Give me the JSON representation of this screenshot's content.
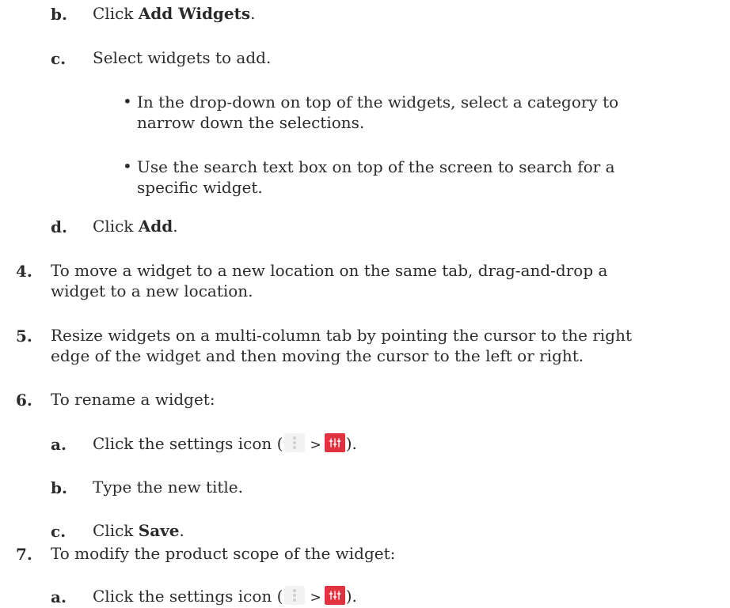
{
  "steps": {
    "b1": {
      "num": "b.",
      "pre": "Click ",
      "bold": "Add Widgets",
      "post": "."
    },
    "c1": {
      "num": "c.",
      "text": "Select widgets to add."
    },
    "bul1": {
      "line1": "In the drop-down on top of the widgets, select a category to",
      "line2": "narrow down the selections."
    },
    "bul2": {
      "line1": "Use the search text box on top of the screen to search for a",
      "line2": "specific widget."
    },
    "d1": {
      "num": "d.",
      "pre": "Click ",
      "bold": "Add",
      "post": "."
    },
    "s4": {
      "num": "4.",
      "line1": "To move a widget to a new location on the same tab, drag-and-drop a",
      "line2": "widget to a new location."
    },
    "s5": {
      "num": "5.",
      "line1": "Resize widgets on a multi-column tab by pointing the cursor to the right",
      "line2": "edge of the widget and then moving the cursor to the left or right."
    },
    "s6": {
      "num": "6.",
      "text": "To rename a widget:"
    },
    "a6": {
      "num": "a.",
      "pre": "Click the settings icon (",
      "sep": ">",
      "post": ")."
    },
    "b6": {
      "num": "b.",
      "text": "Type the new title."
    },
    "c6": {
      "num": "c.",
      "pre": "Click ",
      "bold": "Save",
      "post": "."
    },
    "s7": {
      "num": "7.",
      "text": "To modify the product scope of the widget:"
    },
    "a7": {
      "num": "a.",
      "pre": "Click the settings icon (",
      "sep": ">",
      "post": ")."
    }
  },
  "icons": {
    "menu": "vertical-ellipsis-icon",
    "settings": "sliders-settings-icon",
    "settings_color": "#e0323f"
  }
}
